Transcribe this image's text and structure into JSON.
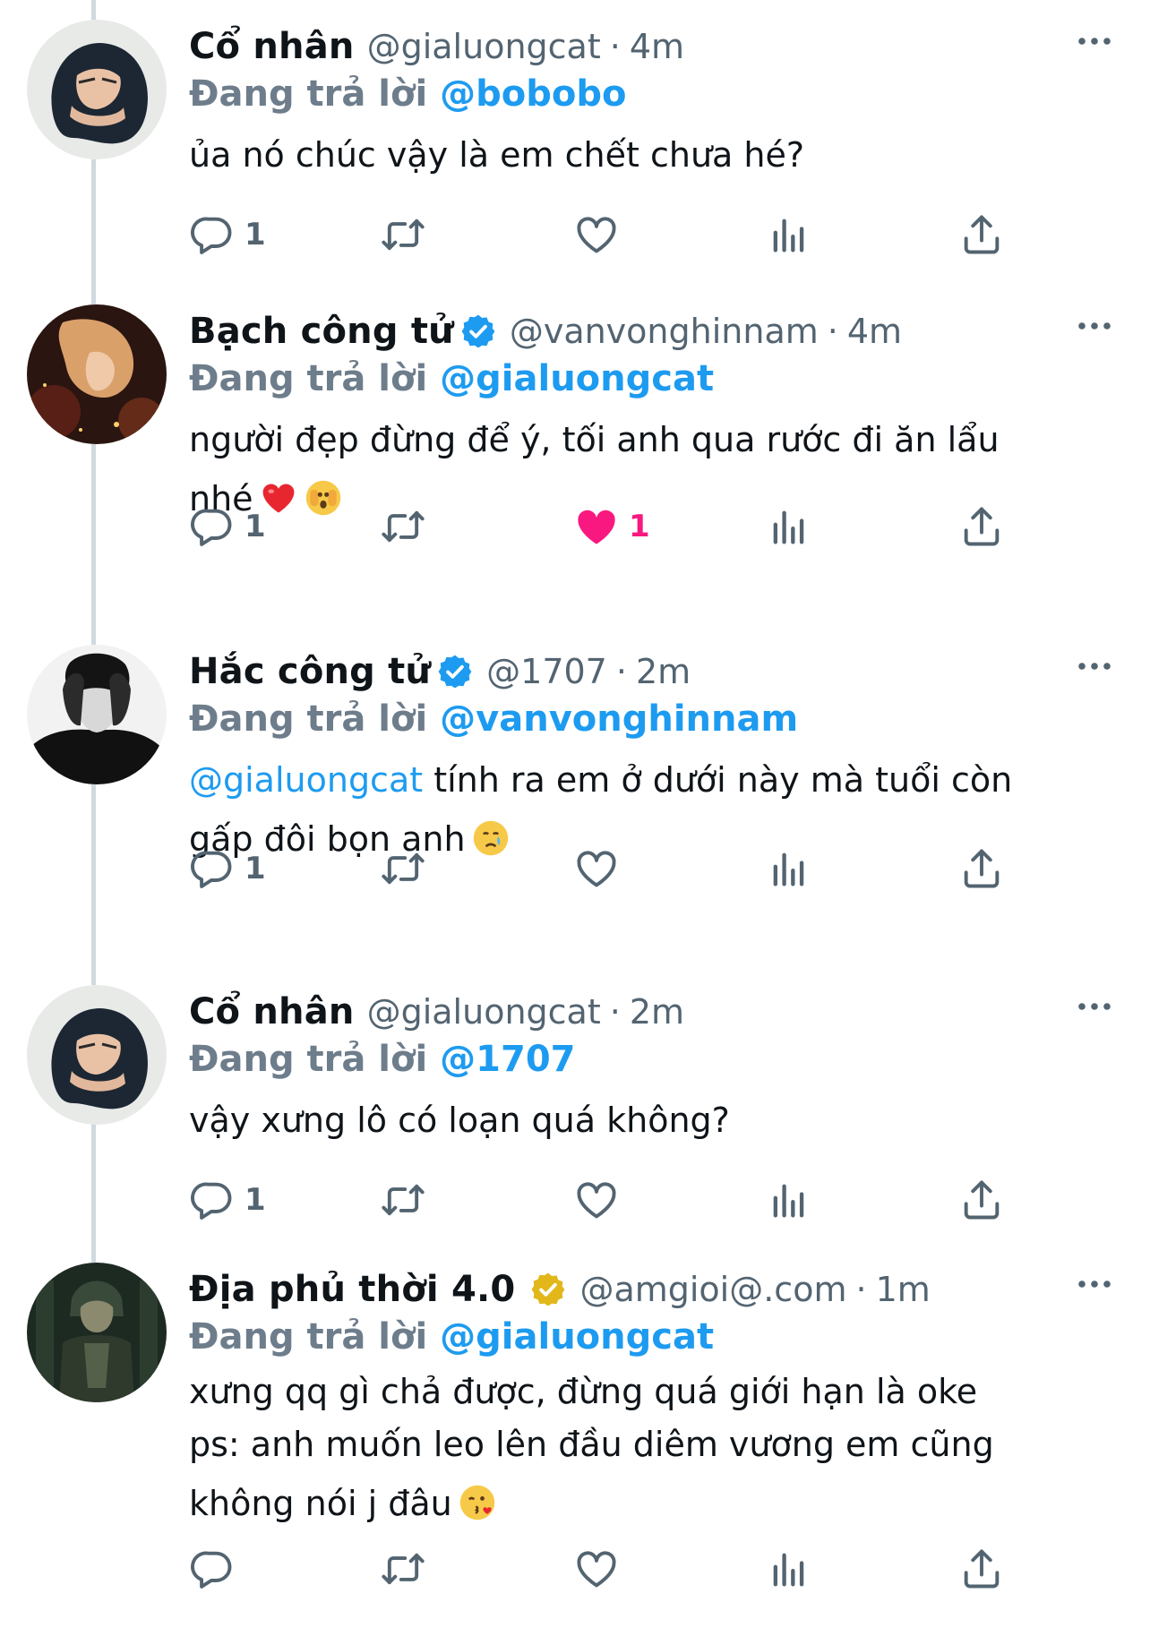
{
  "tweets": [
    {
      "name": "Cổ nhân",
      "verified": false,
      "handle": "@gialuongcat",
      "time": "4m",
      "reply_label": "Đang trả lời",
      "reply_to": "@bobobo",
      "body_line1": "ủa nó chúc vậy là em chết chưa hé?",
      "replies": "1",
      "likes": "",
      "liked": false,
      "avatar_icon": "avatar-gialuongcat"
    },
    {
      "name": "Bạch công tử",
      "verified": true,
      "badge_color": "#1d9bf0",
      "handle": "@vanvonghinnam",
      "time": "4m",
      "reply_label": "Đang trả lời",
      "reply_to": "@gialuongcat",
      "body_line1": "người đẹp đừng để ý, tối anh qua rước đi ăn lẩu",
      "body_line2": "nhé",
      "emojis": [
        "red-heart-emoji",
        "face-peeking-emoji"
      ],
      "replies": "1",
      "likes": "1",
      "liked": true,
      "avatar_icon": "avatar-vanvonghinnam"
    },
    {
      "name": "Hắc công tử",
      "verified": true,
      "badge_color": "#1d9bf0",
      "handle": "@1707",
      "time": "2m",
      "reply_label": "Đang trả lời",
      "reply_to": "@vanvonghinnam",
      "body_mention": "@gialuongcat",
      "body_line1": " tính ra em ở dưới này mà tuổi còn",
      "body_line2": "gấp đôi bọn anh",
      "emojis": [
        "crying-face-emoji"
      ],
      "replies": "1",
      "likes": "",
      "liked": false,
      "avatar_icon": "avatar-1707"
    },
    {
      "name": "Cổ nhân",
      "verified": false,
      "handle": "@gialuongcat",
      "time": "2m",
      "reply_label": "Đang trả lời",
      "reply_to": "@1707",
      "body_line1": "vậy xưng lô có loạn quá không?",
      "replies": "1",
      "likes": "",
      "liked": false,
      "avatar_icon": "avatar-gialuongcat"
    },
    {
      "name": "Địa phủ thời 4.0",
      "verified": true,
      "badge_color": "#e2b719",
      "handle": "@amgioi@.com",
      "time": "1m",
      "reply_label": "Đang trả lời",
      "reply_to": "@gialuongcat",
      "body_line1": "xưng qq gì chả được, đừng quá giới hạn là oke",
      "body_line2": "ps: anh muốn leo lên đầu diêm vương em cũng",
      "body_line3": "không nói j đâu",
      "emojis": [
        "face-blowing-kiss-emoji"
      ],
      "replies": "",
      "likes": "",
      "liked": false,
      "avatar_icon": "avatar-amgioi"
    }
  ],
  "colors": {
    "text": "#0f1419",
    "secondary": "#536471",
    "accent": "#1d9bf0",
    "like": "#f91880",
    "thread_line": "#cfd9de"
  }
}
